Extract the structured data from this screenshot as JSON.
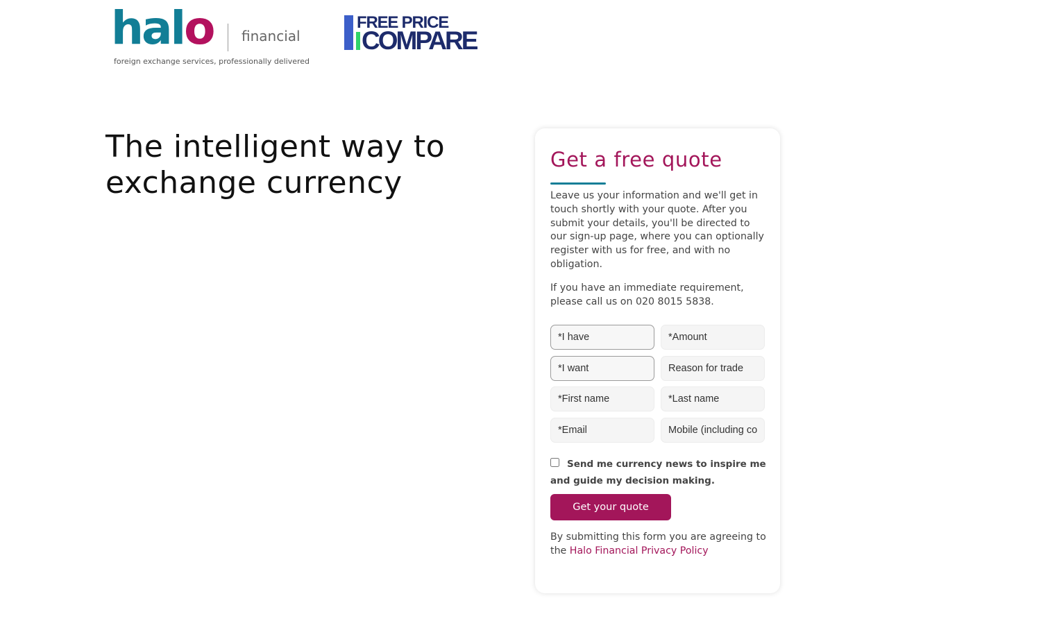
{
  "header": {
    "halo_brand": "halo",
    "halo_sub": "financial",
    "halo_tagline": "foreign exchange services, professionally delivered",
    "fpc_line1": "FREE PRICE",
    "fpc_line2": "COMPARE"
  },
  "hero": {
    "headline": "The intelligent way to exchange currency"
  },
  "form": {
    "title": "Get a free quote",
    "description": "Leave us your information and we'll get in touch shortly with your quote. After you submit your details, you'll be directed to our sign-up page, where you can optionally register with us for free, and with no obligation.",
    "call_text": "If you have an immediate requirement, please call us on 020 8015 5838.",
    "fields": {
      "i_have": "*I have",
      "amount": "*Amount",
      "i_want": "*I want",
      "reason": "Reason for trade",
      "first_name": "*First name",
      "last_name": "*Last name",
      "email": "*Email",
      "mobile": "Mobile (including country code)"
    },
    "newsletter_label": "Send me currency news to inspire me and guide my decision making.",
    "newsletter_checked": false,
    "submit_label": "Get your quote",
    "privacy_prefix": "By submitting this form you are agreeing to the ",
    "privacy_link": "Halo Financial Privacy Policy"
  },
  "colors": {
    "brand_teal": "#127e96",
    "brand_magenta": "#a3165a",
    "fpc_navy": "#1d2b6b",
    "fpc_blue": "#3c5fc9",
    "fpc_green": "#2fd46a"
  }
}
